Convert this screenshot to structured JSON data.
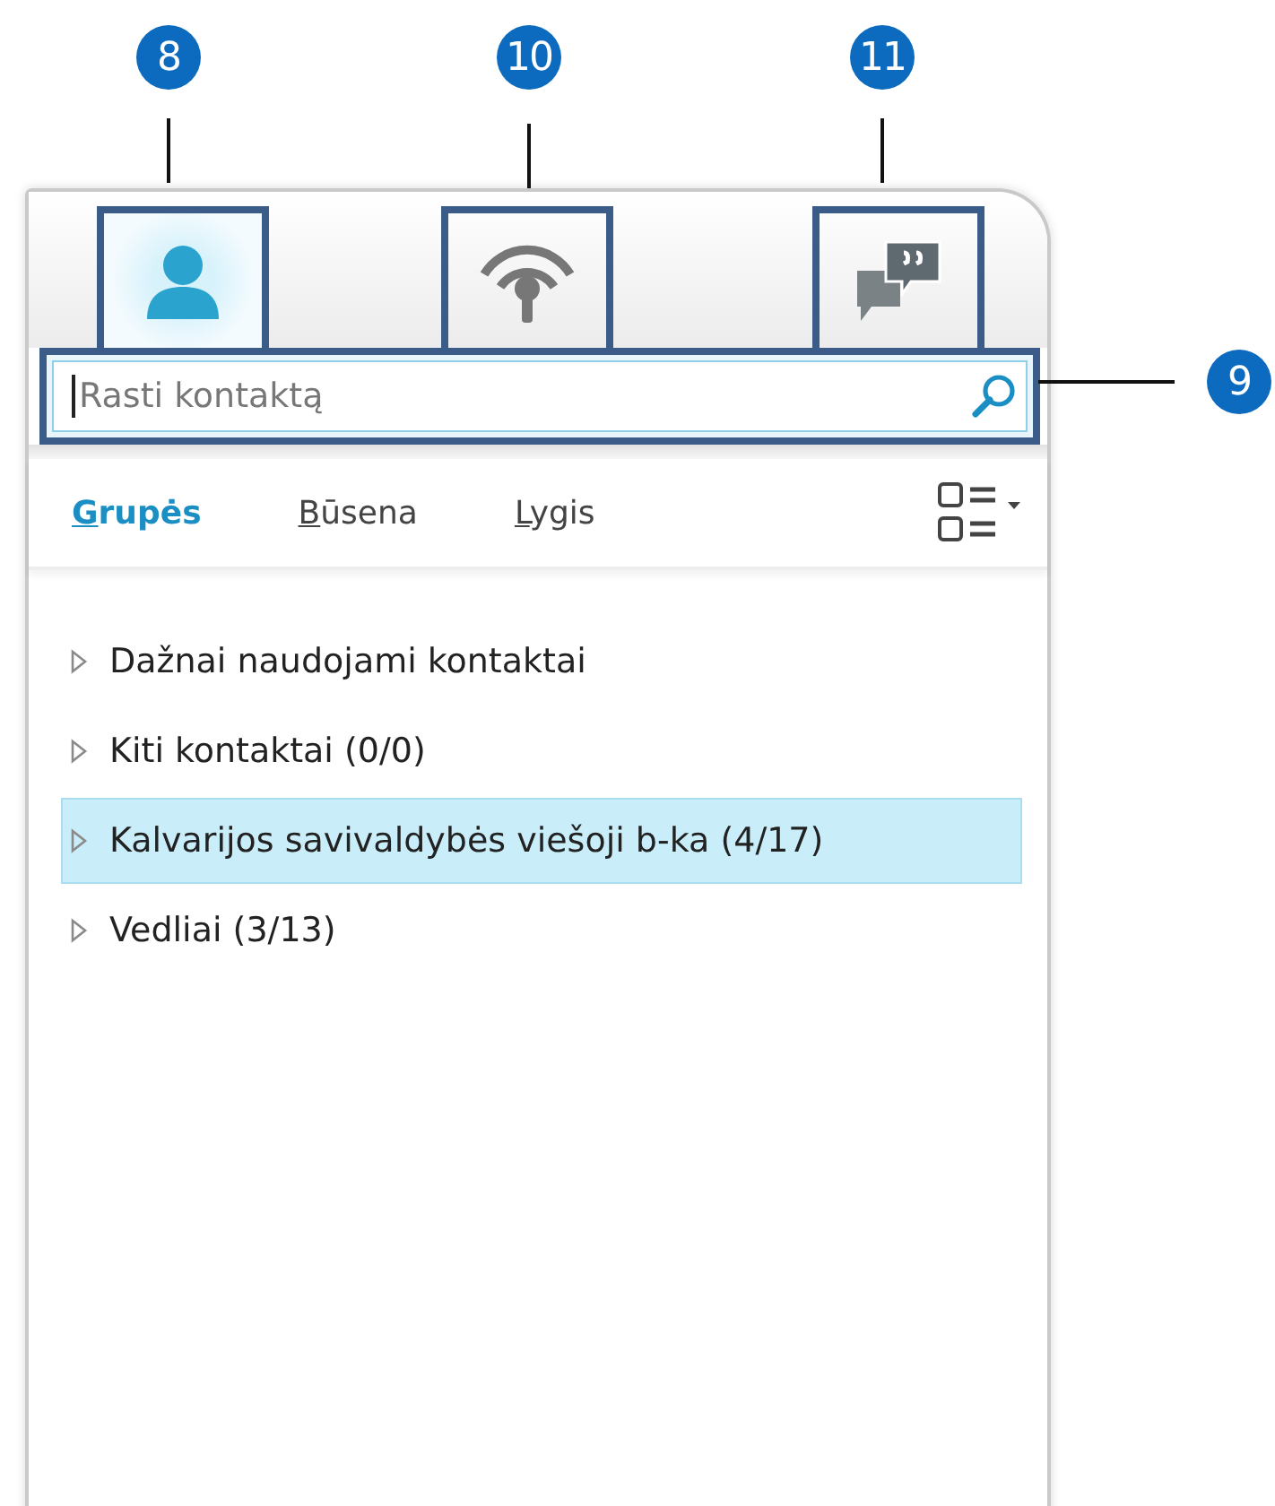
{
  "callouts": [
    {
      "label": "8"
    },
    {
      "label": "10"
    },
    {
      "label": "11"
    },
    {
      "label": "9"
    }
  ],
  "view_tabs": [
    {
      "kind": "contacts",
      "selected": true
    },
    {
      "kind": "activity",
      "selected": false
    },
    {
      "kind": "conversations",
      "selected": false
    }
  ],
  "search": {
    "placeholder": "Rasti kontaktą"
  },
  "filter_tabs": [
    {
      "label": "Grupės",
      "selected": true
    },
    {
      "label": "Būsena",
      "selected": false
    },
    {
      "label": "Lygis",
      "selected": false
    }
  ],
  "groups": [
    {
      "name": "Dažnai naudojami kontaktai",
      "selected": false
    },
    {
      "name": "Kiti kontaktai (0/0)",
      "selected": false
    },
    {
      "name": "Kalvarijos savivaldybės viešoji b-ka (4/17)",
      "selected": true
    },
    {
      "name": "Vedliai (3/13)",
      "selected": false
    }
  ]
}
